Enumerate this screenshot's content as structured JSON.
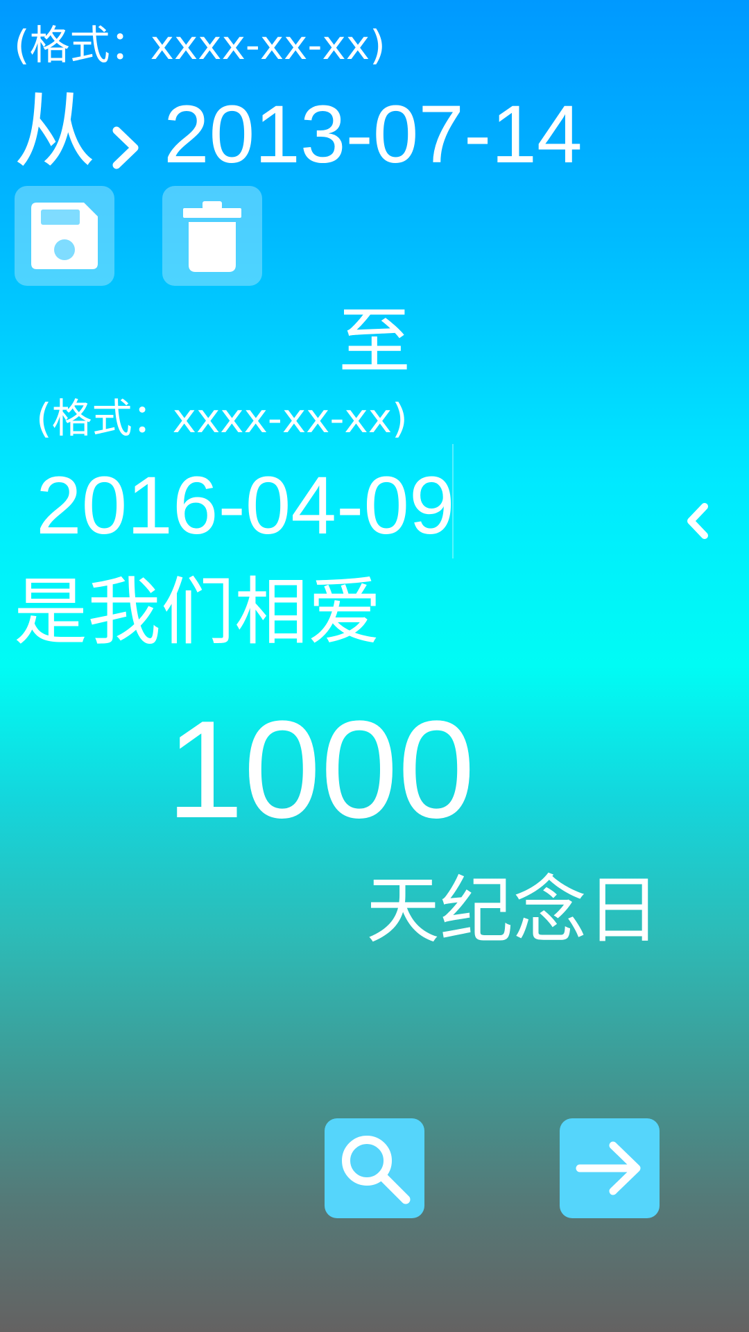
{
  "from_section": {
    "format_hint": "(格式：xxxx-xx-xx)",
    "label": "从",
    "date_value": "2013-07-14"
  },
  "actions": {
    "save_icon": "floppy-disk-icon",
    "delete_icon": "trash-icon"
  },
  "to_section": {
    "label": "至",
    "format_hint": "(格式：xxxx-xx-xx)",
    "date_value": "2016-04-09"
  },
  "result": {
    "prefix_text": "是我们相爱",
    "day_count": "1000",
    "suffix_text": "天纪念日"
  },
  "bottom_actions": {
    "search_icon": "search-icon",
    "next_icon": "arrow-right-icon"
  },
  "colors": {
    "gradient_top": "#0099ff",
    "gradient_mid": "#00fcf5",
    "gradient_bottom": "#646262",
    "button_fill": "#55d5fb",
    "text": "#ffffff"
  }
}
